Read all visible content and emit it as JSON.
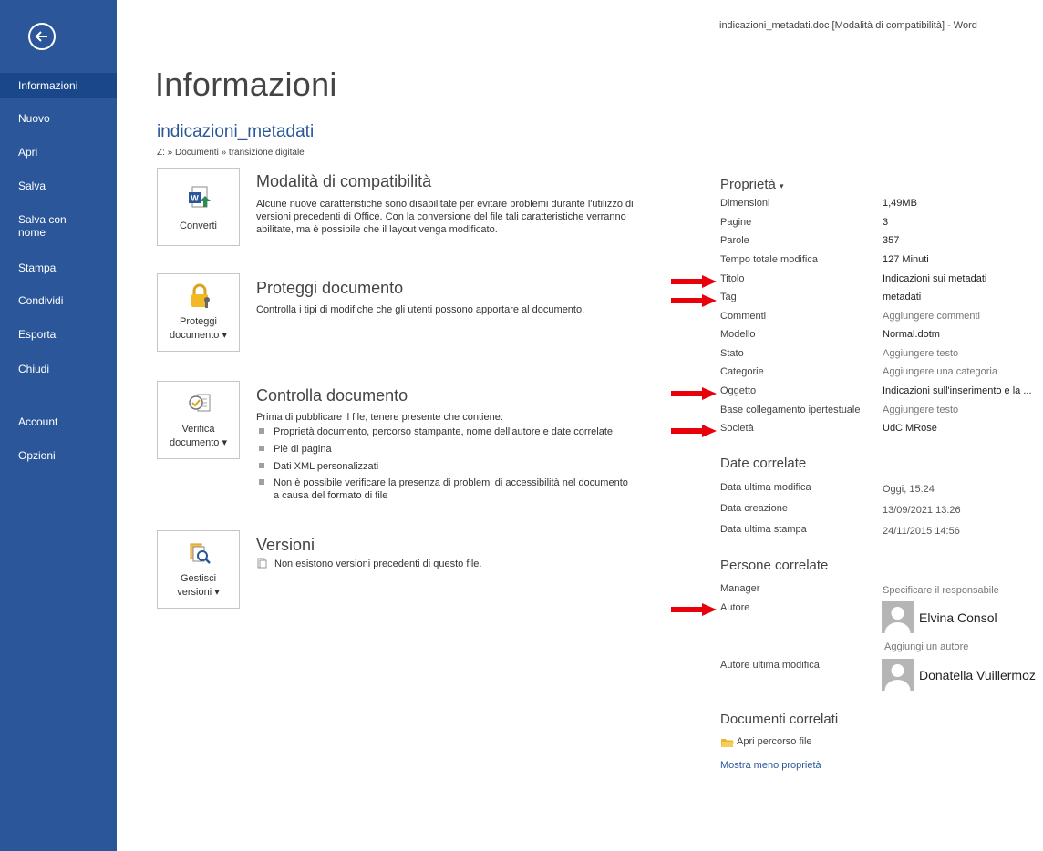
{
  "window": {
    "title": "indicazioni_metadati.doc [Modalità di compatibilità] - Word"
  },
  "colors": {
    "accent": "#2b579a",
    "sidebar_active": "#19478a",
    "arrow": "#e8000b"
  },
  "sidebar": {
    "back_icon": "arrow-left-circle-icon",
    "items": [
      {
        "label": "Informazioni",
        "active": true
      },
      {
        "label": "Nuovo"
      },
      {
        "label": "Apri"
      },
      {
        "label": "Salva"
      },
      {
        "label": "Salva con nome"
      },
      {
        "label": "Stampa"
      },
      {
        "label": "Condividi"
      },
      {
        "label": "Esporta"
      },
      {
        "label": "Chiudi"
      },
      {
        "label": "Account"
      },
      {
        "label": "Opzioni"
      }
    ]
  },
  "main": {
    "title": "Informazioni",
    "doc_name": "indicazioni_metadati",
    "breadcrumb": "Z: » Documenti » transizione digitale",
    "sections": {
      "compat": {
        "button": "Converti",
        "icon": "word-convert-icon",
        "title": "Modalità di compatibilità",
        "text": "Alcune nuove caratteristiche sono disabilitate per evitare problemi durante l'utilizzo di versioni precedenti di Office. Con la conversione del file tali caratteristiche verranno abilitate, ma è possibile che il layout venga modificato."
      },
      "protect": {
        "button_line1": "Proteggi",
        "button_line2": "documento",
        "icon": "lock-key-icon",
        "title": "Proteggi documento",
        "text": "Controlla i tipi di modifiche che gli utenti possono apportare al documento."
      },
      "inspect": {
        "button_line1": "Verifica",
        "button_line2": "documento",
        "icon": "inspect-document-icon",
        "title": "Controlla documento",
        "text": "Prima di pubblicare il file, tenere presente che contiene:",
        "bullets": [
          "Proprietà documento, percorso stampante, nome dell'autore e date correlate",
          "Piè di pagina",
          "Dati XML personalizzati",
          "Non è possibile verificare la presenza di problemi di accessibilità nel documento",
          "a causa del formato di file"
        ]
      },
      "versions": {
        "button_line1": "Gestisci",
        "button_line2": "versioni",
        "icon": "versions-magnifier-icon",
        "title": "Versioni",
        "text": "Non esistono versioni precedenti di questo file."
      }
    }
  },
  "properties": {
    "header": "Proprietà",
    "rows": [
      {
        "label": "Dimensioni",
        "value": "1,49MB"
      },
      {
        "label": "Pagine",
        "value": "3"
      },
      {
        "label": "Parole",
        "value": "357"
      },
      {
        "label": "Tempo totale modifica",
        "value": "127 Minuti"
      },
      {
        "label": "Titolo",
        "value": "Indicazioni sui metadati"
      },
      {
        "label": "Tag",
        "value": "metadati"
      },
      {
        "label": "Commenti",
        "value": "Aggiungere commenti"
      },
      {
        "label": "Modello",
        "value": "Normal.dotm"
      },
      {
        "label": "Stato",
        "value": "Aggiungere testo"
      },
      {
        "label": "Categorie",
        "value": "Aggiungere una categoria"
      },
      {
        "label": "Oggetto",
        "value": "Indicazioni sull'inserimento e la ..."
      },
      {
        "label": "Base collegamento ipertestuale",
        "value": "Aggiungere testo"
      },
      {
        "label": "Società",
        "value": "UdC MRose"
      }
    ],
    "dates_header": "Date correlate",
    "dates": [
      {
        "label": "Data ultima modifica",
        "value": "Oggi, 15:24"
      },
      {
        "label": "Data creazione",
        "value": "13/09/2021 13:26"
      },
      {
        "label": "Data ultima stampa",
        "value": "24/11/2015 14:56"
      }
    ],
    "people_header": "Persone correlate",
    "manager_label": "Manager",
    "manager_value": "Specificare il responsabile",
    "author_label": "Autore",
    "author_name": "Elvina Consol",
    "add_author": "Aggiungi un autore",
    "last_author_label": "Autore ultima modifica",
    "last_author_name": "Donatella Vuillermoz",
    "related_docs_header": "Documenti correlati",
    "open_path": "Apri percorso file",
    "show_less": "Mostra meno proprietà"
  }
}
